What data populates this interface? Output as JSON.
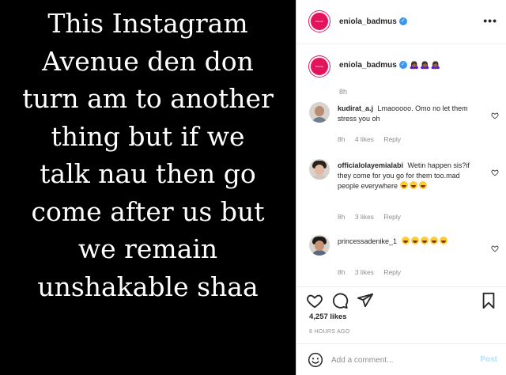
{
  "media": {
    "lines": [
      "This Instagram",
      "Avenue den don",
      "turn am to another",
      "thing but if we",
      "talk nau then go",
      "come after us but",
      "we remain",
      "unshakable shaa"
    ]
  },
  "header": {
    "username": "eniola_badmus",
    "avatar_text": "Eniola",
    "more_label": "•••"
  },
  "caption": {
    "username": "eniola_badmus",
    "emojis": "🙇🏾‍♀️🙇🏾‍♀️🙇🏾‍♀️",
    "time": "8h"
  },
  "comments": [
    {
      "username": "kudirat_a.j",
      "text": "Lmaooooo. Omo no let them stress you oh",
      "time": "8h",
      "likes": "4 likes",
      "reply": "Reply"
    },
    {
      "username": "officialolayemialabi",
      "text": "Wetin happen sis?if they come for you go for them too.mad people everywhere",
      "time": "8h",
      "likes": "3 likes",
      "reply": "Reply"
    },
    {
      "username": "princessadenike_1",
      "text": "",
      "time": "8h",
      "likes": "3 likes",
      "reply": "Reply"
    }
  ],
  "actions": {
    "likes": "4,257 likes",
    "posted_ago": "8 HOURS AGO"
  },
  "add_comment": {
    "placeholder": "Add a comment...",
    "post_label": "Post"
  }
}
